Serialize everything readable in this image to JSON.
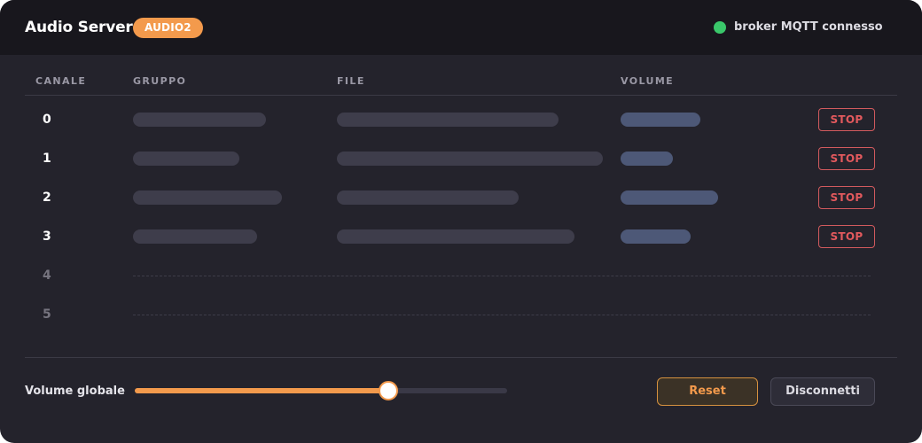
{
  "header": {
    "title": "Audio Server",
    "badge": "AUDIO2",
    "status_text": "broker MQTT connesso",
    "status_color": "#3ac76a"
  },
  "table": {
    "columns": [
      "CANALE",
      "GRUPPO",
      "FILE",
      "VOLUME"
    ],
    "rows": [
      {
        "channel": "0",
        "active": true,
        "volume_level": 0.41,
        "stop_label": "STOP"
      },
      {
        "channel": "1",
        "active": true,
        "volume_level": 0.27,
        "stop_label": "STOP"
      },
      {
        "channel": "2",
        "active": true,
        "volume_level": 0.5,
        "stop_label": "STOP"
      },
      {
        "channel": "3",
        "active": true,
        "volume_level": 0.36,
        "stop_label": "STOP"
      },
      {
        "channel": "4",
        "active": false
      },
      {
        "channel": "5",
        "active": false
      }
    ]
  },
  "footer": {
    "volume_label": "Volume globale",
    "global_volume": 0.68,
    "reset_label": "Reset",
    "disconnect_label": "Disconnetti"
  },
  "colors": {
    "accent": "#f39a4c",
    "stop": "#e2595d",
    "background": "#24232c",
    "header": "#18171d"
  }
}
